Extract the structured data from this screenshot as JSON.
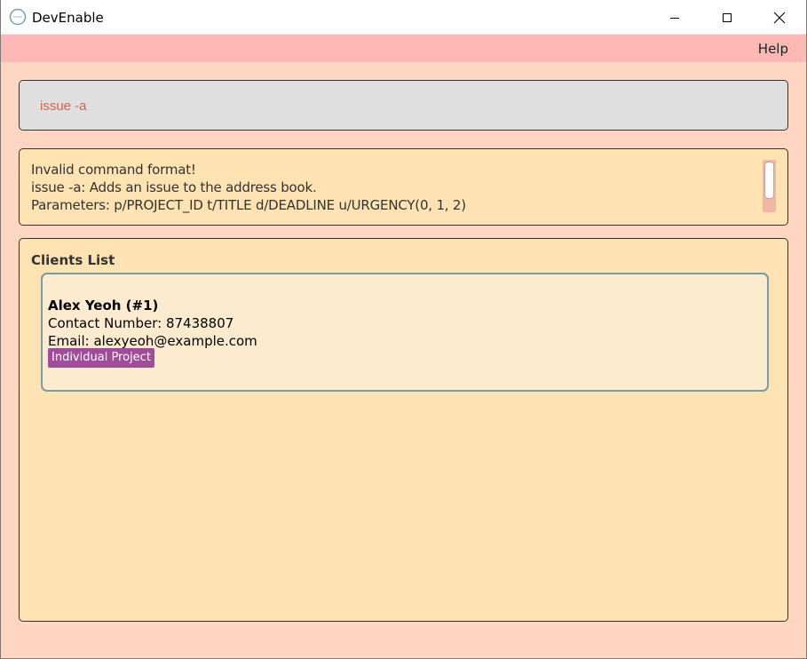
{
  "window": {
    "title": "DevEnable"
  },
  "menu": {
    "help": "Help"
  },
  "command": {
    "value": "issue -a"
  },
  "result": {
    "lines": [
      "Invalid command format!",
      "issue -a: Adds an issue to the address book.",
      "Parameters: p/PROJECT_ID t/TITLE d/DEADLINE u/URGENCY(0, 1, 2)"
    ]
  },
  "clients": {
    "title": "Clients List",
    "items": [
      {
        "name": "Alex Yeoh (#1)",
        "phone": "Contact Number: 87438807",
        "email": "Email: alexyeoh@example.com",
        "tags": [
          "Individual Project"
        ]
      }
    ]
  },
  "colors": {
    "background": "#ffd6c2",
    "menubar": "#ffb9b5",
    "panel": "#ffe3b3",
    "command_box": "#dfdfdf",
    "command_text": "#d9604b",
    "card": "#fdebcf",
    "card_border": "#7a9aa6",
    "tag": "#a04c9b"
  }
}
